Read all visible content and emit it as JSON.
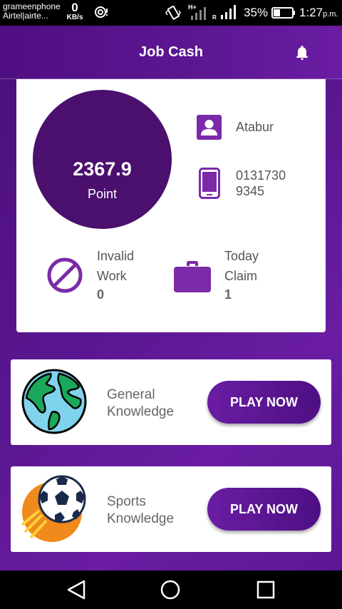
{
  "status_bar": {
    "carrier_line1": "grameenphone",
    "carrier_line2": "Airtel|airte...",
    "speed_value": "0",
    "speed_unit": "KB/s",
    "network_type": "H+",
    "roaming": "R",
    "battery_percent": "35%",
    "time": "1:27",
    "time_suffix": "p.m."
  },
  "app_bar": {
    "title": "Job Cash",
    "notification_icon": "bell-icon"
  },
  "profile": {
    "points_value": "2367.9",
    "points_label": "Point",
    "name": "Atabur",
    "phone": "01317309345",
    "invalid_label": "Invalid Work",
    "invalid_count": "0",
    "claim_label": "Today Claim",
    "claim_count": "1"
  },
  "games": [
    {
      "label": "General Knowledge",
      "button": "PLAY NOW",
      "icon": "globe-icon"
    },
    {
      "label": "Sports Knowledge",
      "button": "PLAY NOW",
      "icon": "soccer-ball-icon"
    }
  ],
  "colors": {
    "primary": "#5c1793",
    "primary_dark": "#4b0f6e",
    "accent": "#7b2aa8"
  }
}
